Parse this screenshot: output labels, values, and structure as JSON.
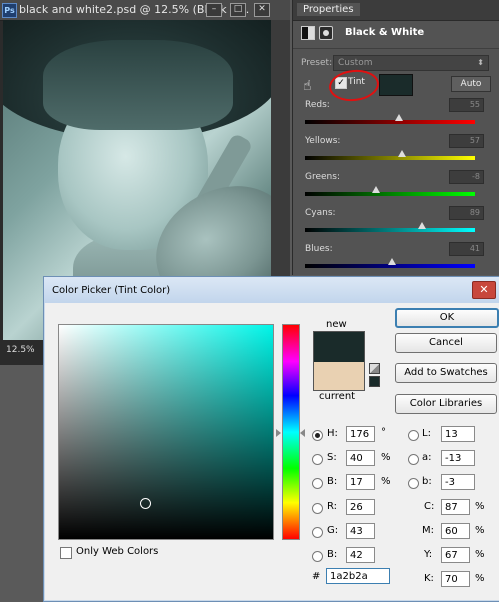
{
  "document": {
    "tab_title": "black and white2.psd @ 12.5% (Black &...",
    "ps_icon": "Ps",
    "zoom": "12.5%",
    "window_buttons": [
      "–",
      "□",
      "✕"
    ]
  },
  "properties": {
    "tab": "Properties",
    "adjustment_name": "Black & White",
    "preset_label": "Preset:",
    "preset_value": "Custom",
    "tint_label": "Tint",
    "tint_checked": true,
    "tint_color": "#1a2b2a",
    "auto_label": "Auto",
    "sliders": [
      {
        "label": "Reds:",
        "value": "55",
        "position": 55
      },
      {
        "label": "Yellows:",
        "value": "57",
        "position": 57
      },
      {
        "label": "Greens:",
        "value": "-8",
        "position": 42
      },
      {
        "label": "Cyans:",
        "value": "89",
        "position": 69
      },
      {
        "label": "Blues:",
        "value": "41",
        "position": 51
      }
    ]
  },
  "color_picker": {
    "title": "Color Picker (Tint Color)",
    "close": "✕",
    "new_label": "new",
    "current_label": "current",
    "new_color": "#1a2b2a",
    "current_color": "#e9d1b2",
    "buttons": {
      "ok": "OK",
      "cancel": "Cancel",
      "add_to_swatches": "Add to Swatches",
      "color_libraries": "Color Libraries"
    },
    "hsb": {
      "h": {
        "label": "H:",
        "value": "176",
        "unit": "°"
      },
      "s": {
        "label": "S:",
        "value": "40",
        "unit": "%"
      },
      "b": {
        "label": "B:",
        "value": "17",
        "unit": "%"
      }
    },
    "rgb": {
      "r": {
        "label": "R:",
        "value": "26"
      },
      "g": {
        "label": "G:",
        "value": "43"
      },
      "b": {
        "label": "B:",
        "value": "42"
      }
    },
    "lab": {
      "l": {
        "label": "L:",
        "value": "13"
      },
      "a": {
        "label": "a:",
        "value": "-13"
      },
      "b": {
        "label": "b:",
        "value": "-3"
      }
    },
    "cmyk": {
      "c": {
        "label": "C:",
        "value": "87",
        "unit": "%"
      },
      "m": {
        "label": "M:",
        "value": "60",
        "unit": "%"
      },
      "y": {
        "label": "Y:",
        "value": "67",
        "unit": "%"
      },
      "k": {
        "label": "K:",
        "value": "70",
        "unit": "%"
      }
    },
    "hex_label": "#",
    "hex_value": "1a2b2a",
    "only_web_colors": "Only Web Colors",
    "field_cursor": {
      "saturation": 40,
      "brightness": 17
    }
  }
}
